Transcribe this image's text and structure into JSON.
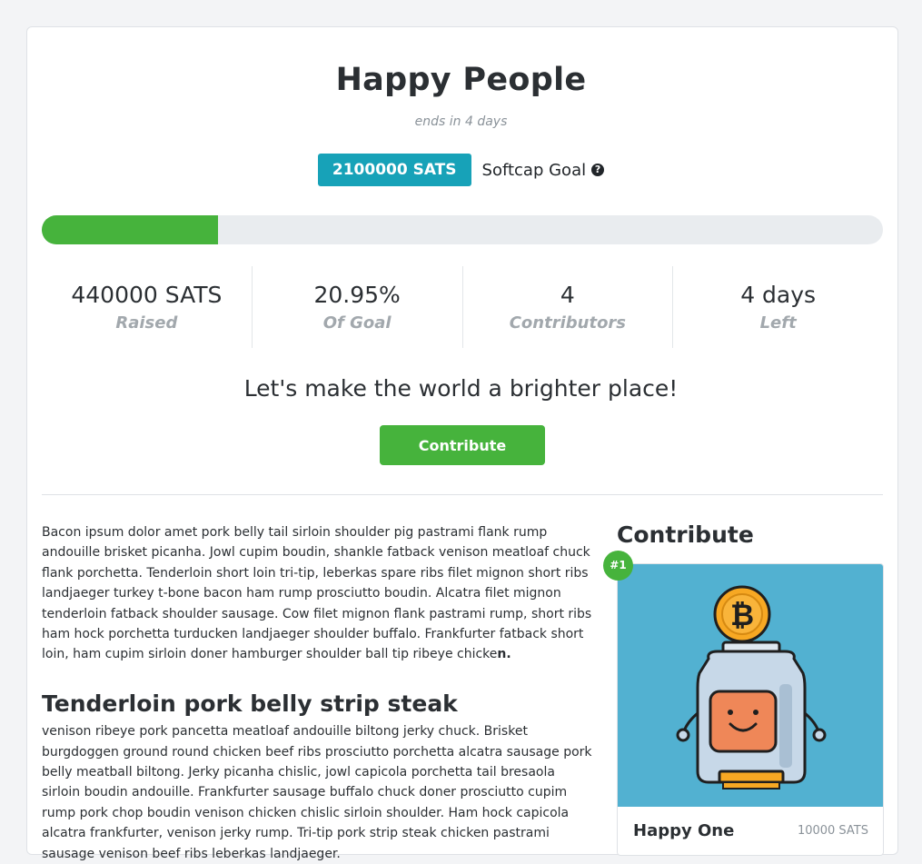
{
  "campaign": {
    "title": "Happy People",
    "ends_text": "ends in 4 days",
    "goal_amount": "2100000 SATS",
    "goal_label": "Softcap Goal",
    "progress_fraction": 0.2095
  },
  "stats": [
    {
      "value": "440000 SATS",
      "label": "Raised"
    },
    {
      "value": "20.95%",
      "label": "Of Goal"
    },
    {
      "value": "4",
      "label": "Contributors"
    },
    {
      "value": "4 days",
      "label": "Left"
    }
  ],
  "tagline": "Let's make the world a brighter place!",
  "contribute_button": "Contribute",
  "description": {
    "para1": "Bacon ipsum dolor amet pork belly tail sirloin shoulder pig pastrami flank rump andouille brisket picanha. Jowl cupim boudin, shankle fatback venison meatloaf chuck flank porchetta. Tenderloin short loin tri-tip, leberkas spare ribs filet mignon short ribs landjaeger turkey t-bone bacon ham rump prosciutto boudin. Alcatra filet mignon tenderloin fatback shoulder sausage. Cow filet mignon flank pastrami rump, short ribs ham hock porchetta turducken landjaeger shoulder buffalo. Frankfurter fatback short loin, ham cupim sirloin doner hamburger shoulder ball tip ribeye chicke",
    "para1_bold_end": "n.",
    "heading": "Tenderloin pork belly strip steak",
    "para2": "venison ribeye pork pancetta meatloaf andouille biltong jerky chuck. Brisket burgdoggen ground round chicken beef ribs prosciutto porchetta alcatra sausage pork belly meatball biltong. Jerky picanha chislic, jowl capicola porchetta tail bresaola sirloin boudin andouille. Frankfurter sausage buffalo chuck doner prosciutto cupim rump pork chop boudin venison chicken chislic sirloin shoulder. Ham hock capicola alcatra frankfurter, venison jerky rump. Tri-tip pork strip steak chicken pastrami sausage venison beef ribs leberkas landjaeger."
  },
  "sidebar": {
    "title": "Contribute",
    "reward": {
      "rank": "#1",
      "name": "Happy One",
      "price": "10000 SATS",
      "image_icon": "bitcoin-jar-robot-icon"
    }
  },
  "colors": {
    "accent_green": "#46b33c",
    "badge_teal": "#17a2b8",
    "reward_bg": "#52b1d1",
    "bitcoin_orange": "#f7a823"
  }
}
